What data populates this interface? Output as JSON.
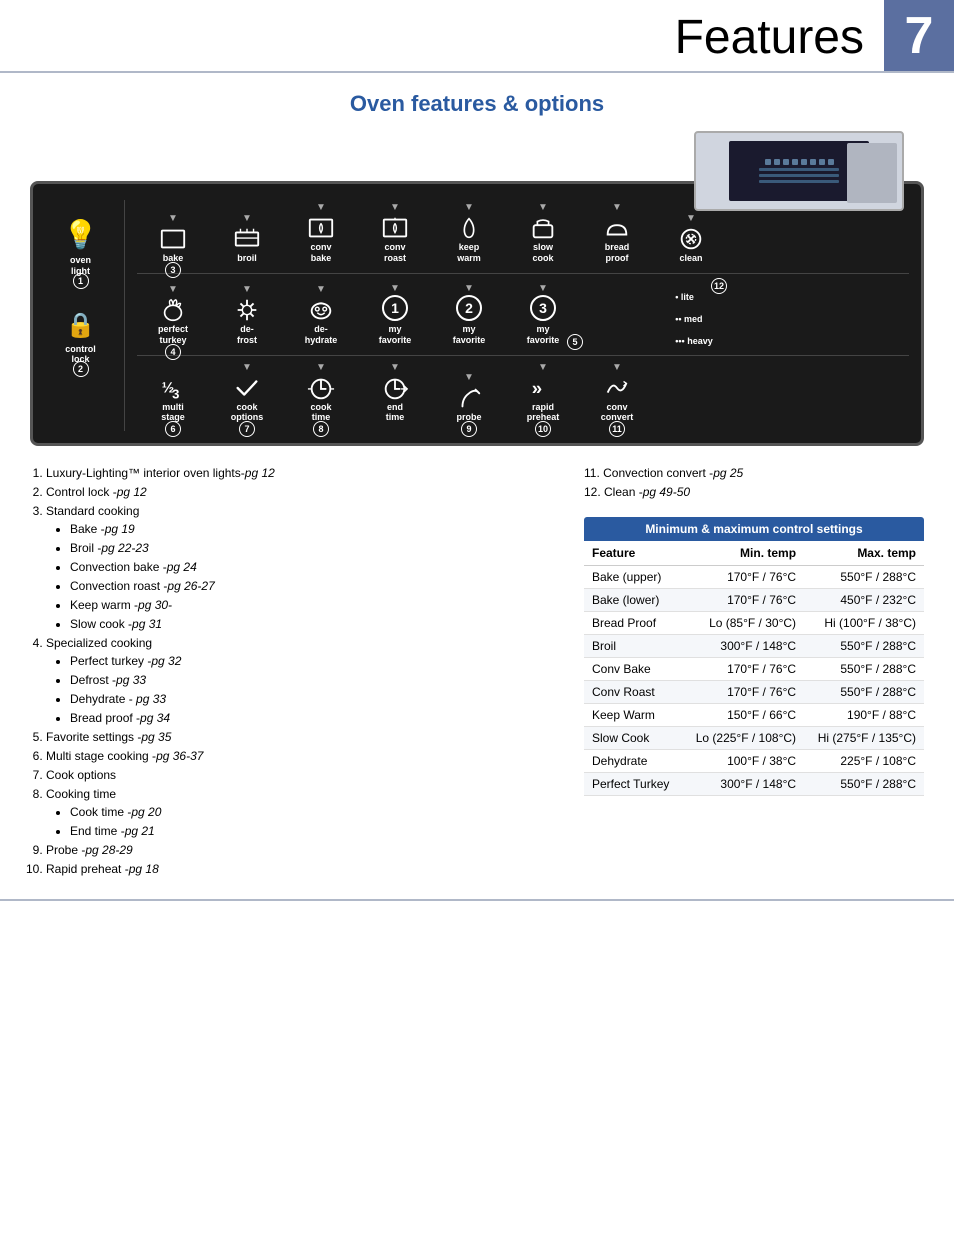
{
  "header": {
    "title": "Features",
    "page_number": "7"
  },
  "section_title": "Oven features & options",
  "panel": {
    "row1_keys": [
      {
        "symbol": "💡",
        "label": "oven\nlight",
        "has_arrow": false,
        "badge": "1"
      },
      {
        "symbol": "□",
        "label": "bake",
        "has_arrow": true,
        "badge": "3"
      },
      {
        "symbol": "⊓⊓",
        "label": "broil",
        "has_arrow": true
      },
      {
        "symbol": "⊓Y",
        "label": "conv\nbake",
        "has_arrow": true
      },
      {
        "symbol": "⊓Ŷ",
        "label": "conv\nroast",
        "has_arrow": true
      },
      {
        "symbol": "∫",
        "label": "keep\nwarm",
        "has_arrow": true
      },
      {
        "symbol": "□",
        "label": "slow\ncook",
        "has_arrow": true
      },
      {
        "symbol": "⌂",
        "label": "bread\nproof",
        "has_arrow": true
      },
      {
        "symbol": "❋",
        "label": "clean",
        "has_arrow": true
      }
    ],
    "row2_keys": [
      {
        "symbol": "🔒",
        "label": "control\nlock",
        "has_arrow": false,
        "badge": "2"
      },
      {
        "symbol": "🍗",
        "label": "perfect\nturkey",
        "has_arrow": true,
        "badge": "4"
      },
      {
        "symbol": "❄️",
        "label": "de-\nfrost",
        "has_arrow": true
      },
      {
        "symbol": "💧",
        "label": "de-\nhydrate",
        "has_arrow": true
      },
      {
        "symbol": "①",
        "label": "my\nfavorite",
        "has_arrow": true
      },
      {
        "symbol": "②",
        "label": "my\nfavorite",
        "has_arrow": true
      },
      {
        "symbol": "③",
        "label": "my\nfavorite",
        "has_arrow": true,
        "badge": "5"
      }
    ],
    "row3_keys": [
      {
        "symbol": "½\n3",
        "label": "multi\nstage",
        "has_arrow": false,
        "badge": "6"
      },
      {
        "symbol": "✓",
        "label": "cook\noptions",
        "has_arrow": true,
        "badge": "7"
      },
      {
        "symbol": "↔",
        "label": "cook\ntime",
        "has_arrow": true,
        "badge": "8"
      },
      {
        "symbol": "→|",
        "label": "end\ntime",
        "has_arrow": true
      },
      {
        "symbol": "⌒",
        "label": "probe",
        "has_arrow": true,
        "badge": "9"
      },
      {
        "symbol": "»",
        "label": "rapid\npreheat",
        "has_arrow": true,
        "badge": "10"
      },
      {
        "symbol": "⋈",
        "label": "conv\nconvert",
        "has_arrow": true,
        "badge": "11"
      }
    ],
    "right_indicators": [
      "lite",
      "med",
      "heavy"
    ],
    "indicator_badge": "12"
  },
  "notes": {
    "left_items": [
      "1. Luxury-Lighting™ interior oven lights-pg 12",
      "2. Control lock -pg 12",
      "3. Standard cooking",
      "• Bake -pg 19",
      "• Broil -pg 22-23",
      "• Convection bake -pg 24",
      "• Convection roast -pg 26-27",
      "• Keep warm -pg 30-",
      "• Slow cook -pg 31",
      "4. Specialized cooking",
      "• Perfect turkey -pg 32",
      "• Defrost -pg 33",
      "• Dehydrate - pg 33",
      "• Bread proof  -pg 34",
      "5. Favorite settings -pg 35",
      "6. Multi stage cooking -pg 36-37",
      "7. Cook options",
      "8. Cooking time",
      "• Cook time -pg 20",
      "• End time -pg 21",
      "9. Probe -pg 28-29",
      "10. Rapid preheat -pg 18"
    ],
    "right_items": [
      "11. Convection convert -pg 25",
      "12. Clean -pg 49-50"
    ]
  },
  "table": {
    "title": "Minimum & maximum control settings",
    "headers": [
      "Feature",
      "Min. temp",
      "Max. temp"
    ],
    "rows": [
      [
        "Bake (upper)",
        "170°F / 76°C",
        "550°F / 288°C"
      ],
      [
        "Bake (lower)",
        "170°F / 76°C",
        "450°F / 232°C"
      ],
      [
        "Bread Proof",
        "Lo (85°F / 30°C)",
        "Hi (100°F / 38°C)"
      ],
      [
        "Broil",
        "300°F / 148°C",
        "550°F / 288°C"
      ],
      [
        "Conv Bake",
        "170°F / 76°C",
        "550°F / 288°C"
      ],
      [
        "Conv Roast",
        "170°F / 76°C",
        "550°F / 288°C"
      ],
      [
        "Keep  Warm",
        "150°F / 66°C",
        "190°F / 88°C"
      ],
      [
        "Slow Cook",
        "Lo (225°F / 108°C)",
        "Hi (275°F / 135°C)"
      ],
      [
        "Dehydrate",
        "100°F / 38°C",
        "225°F / 108°C"
      ],
      [
        "Perfect Turkey",
        "300°F / 148°C",
        "550°F / 288°C"
      ]
    ]
  }
}
